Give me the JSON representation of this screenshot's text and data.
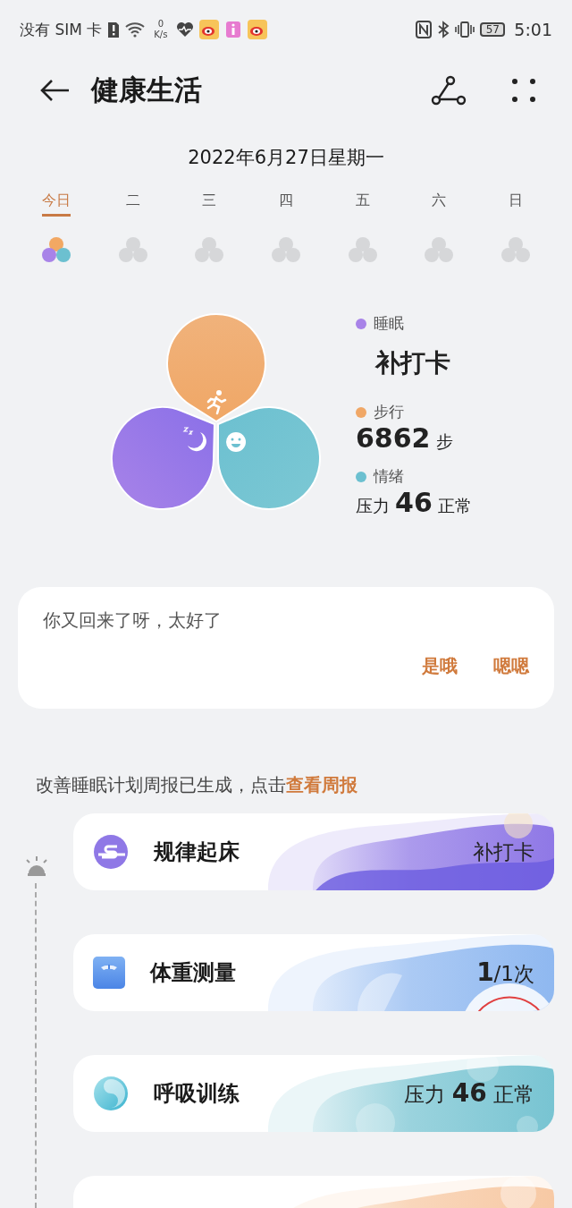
{
  "status_bar": {
    "carrier": "没有 SIM 卡",
    "speed_value": "0",
    "speed_unit": "K/s",
    "battery": "57",
    "time": "5:01"
  },
  "header": {
    "title": "健康生活"
  },
  "date": "2022年6月27日星期一",
  "week": [
    {
      "label": "今日",
      "selected": true,
      "recorded": true
    },
    {
      "label": "二",
      "selected": false,
      "recorded": false
    },
    {
      "label": "三",
      "selected": false,
      "recorded": false
    },
    {
      "label": "四",
      "selected": false,
      "recorded": false
    },
    {
      "label": "五",
      "selected": false,
      "recorded": false
    },
    {
      "label": "六",
      "selected": false,
      "recorded": false
    },
    {
      "label": "日",
      "selected": false,
      "recorded": false
    }
  ],
  "summary": [
    {
      "label": "睡眠",
      "value": "补打卡",
      "kind": "status",
      "color": "#a883e8"
    },
    {
      "label": "步行",
      "value": "**6862** 步",
      "kind": "reading",
      "color": "#f0a766"
    },
    {
      "label": "情绪",
      "value": "压力 **46** 正常",
      "kind": "reading",
      "color": "#6cc0d0"
    }
  ],
  "message": {
    "text": "你又回来了呀，太好了",
    "actions": [
      "是哦",
      "嗯嗯"
    ]
  },
  "plan_notice": {
    "text": "改善睡眠计划周报已生成，点击",
    "link": "查看周报"
  },
  "tasks": [
    {
      "kind": "wake",
      "title": "规律起床",
      "value": "补打卡",
      "color": "#8f78e6"
    },
    {
      "kind": "weight",
      "title": "体重测量",
      "value": "**1**/1次",
      "color": "#8fb8f0"
    },
    {
      "kind": "breath",
      "title": "呼吸训练",
      "value": "压力 **46** 正常",
      "color": "#78c4d2"
    },
    {
      "kind": "blank",
      "color": "#f7c9a4"
    }
  ]
}
